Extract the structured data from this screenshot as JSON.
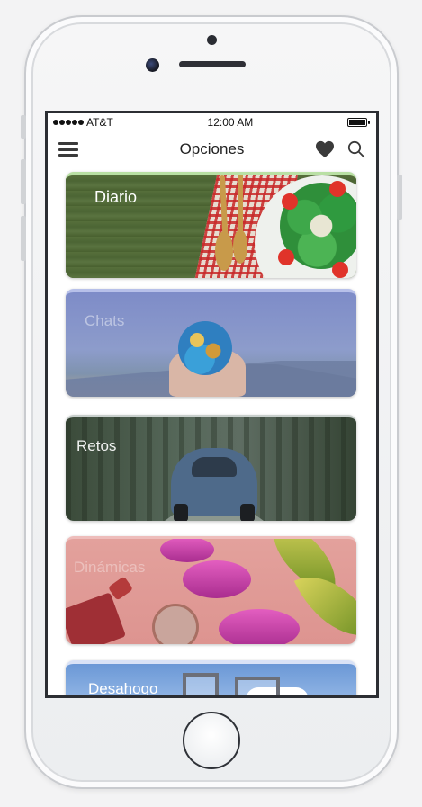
{
  "status_bar": {
    "carrier": "AT&T",
    "time": "12:00 AM"
  },
  "navbar": {
    "title": "Opciones",
    "menu_icon": "hamburger-menu-icon",
    "favorite_icon": "heart-icon",
    "search_icon": "search-icon"
  },
  "cards": [
    {
      "label": "Diario"
    },
    {
      "label": "Chats"
    },
    {
      "label": "Retos"
    },
    {
      "label": "Dinámicas"
    },
    {
      "label": "Desahogo"
    }
  ],
  "colors": {
    "label_text": "#ffffff",
    "icon_dark": "#3a3a3a",
    "screen_bg": "#ffffff"
  }
}
